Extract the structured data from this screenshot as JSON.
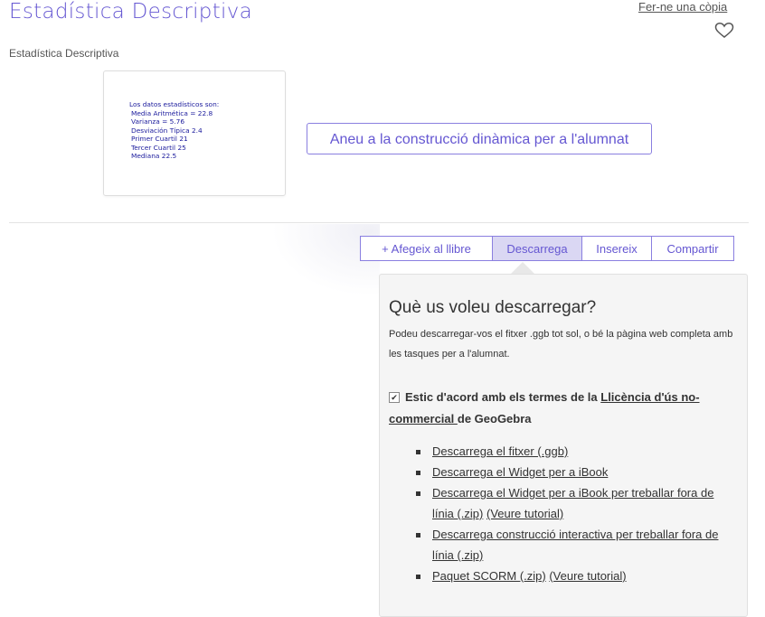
{
  "header": {
    "title": "Estadística Descriptiva",
    "copy_link": "Fer-ne una còpia",
    "favorite_icon": "heart-outline-icon"
  },
  "subtitle": "Estadística Descriptiva",
  "thumbnail": {
    "lines": [
      "Los datos estadísticos son:",
      "Media Aritmética = 22.8",
      "Varianza = 5.76",
      "Desviación Típica 2.4",
      "Primer Cuartil  21",
      "Tercer Cuartil 25",
      "Mediana 22.5"
    ]
  },
  "go_button": "Aneu a la construcció dinàmica per a l'alumnat",
  "tabs": [
    "+ Afegeix al llibre",
    "Descarrega",
    "Insereix",
    "Compartir"
  ],
  "active_tab": "Descarrega",
  "download_panel": {
    "heading": "Què us voleu descarregar?",
    "description": "Podeu descarregar-vos el fitxer .ggb tot sol, o bé la pàgina web completa amb les tasques per a l'alumnat.",
    "agree_prefix": "Estic d'acord amb els termes de la ",
    "agree_link": "Llicència d'ús no-commercial ",
    "agree_suffix": "de GeoGebra",
    "agree_checked": true,
    "items": [
      {
        "link": "Descarrega el fitxer (.ggb)"
      },
      {
        "link": "Descarrega el Widget per a iBook"
      },
      {
        "link": "Descarrega el Widget per a iBook per treballar fora de línia (.zip)",
        "tutorial": "(Veure tutorial)"
      },
      {
        "link": "Descarrega construcció interactiva per treballar fora de línia (.zip)"
      },
      {
        "link": "Paquet SCORM (.zip)",
        "tutorial": "(Veure tutorial)"
      }
    ]
  },
  "colors": {
    "accent": "#6557d2",
    "active_tab_bg": "#dad7f3",
    "panel_bg": "#f5f5f5"
  }
}
